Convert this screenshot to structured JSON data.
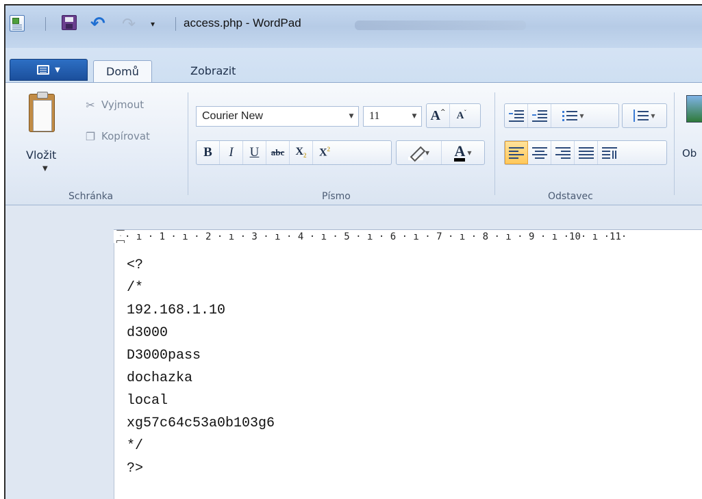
{
  "window": {
    "title": "access.php - WordPad"
  },
  "tabs": [
    {
      "label": "Domů",
      "active": true
    },
    {
      "label": "Zobrazit",
      "active": false
    }
  ],
  "clipboard": {
    "paste_label": "Vložit",
    "cut_label": "Vyjmout",
    "copy_label": "Kopírovat",
    "group_label": "Schránka"
  },
  "font": {
    "family": "Courier New",
    "size": "11",
    "group_label": "Písmo",
    "bold_glyph": "B",
    "italic_glyph": "I",
    "underline_glyph": "U",
    "strike_glyph": "abc",
    "subscript_glyph": "X",
    "superscript_glyph": "X",
    "grow_glyph": "A",
    "shrink_glyph": "A",
    "color_glyph": "A"
  },
  "paragraph": {
    "group_label": "Odstavec",
    "active_alignment": "left"
  },
  "insert": {
    "partial_label": "Ob"
  },
  "ruler": {
    "text": "· ı · 1 · ı · 2 · ı · 3 · ı · 4 · ı · 5 · ı · 6 · ı · 7 · ı · 8 · ı · 9 · ı ·10· ı ·11·"
  },
  "document": {
    "lines": [
      "<?",
      "/*",
      "192.168.1.10",
      "d3000",
      "D3000pass",
      "dochazka",
      "local",
      "xg57c64c53a0b103g6",
      "*/",
      "?>"
    ]
  },
  "colors": {
    "accent": "#1b4f9c",
    "ribbon_bg": "#e3ebf6",
    "active_button": "#ffc85a"
  }
}
